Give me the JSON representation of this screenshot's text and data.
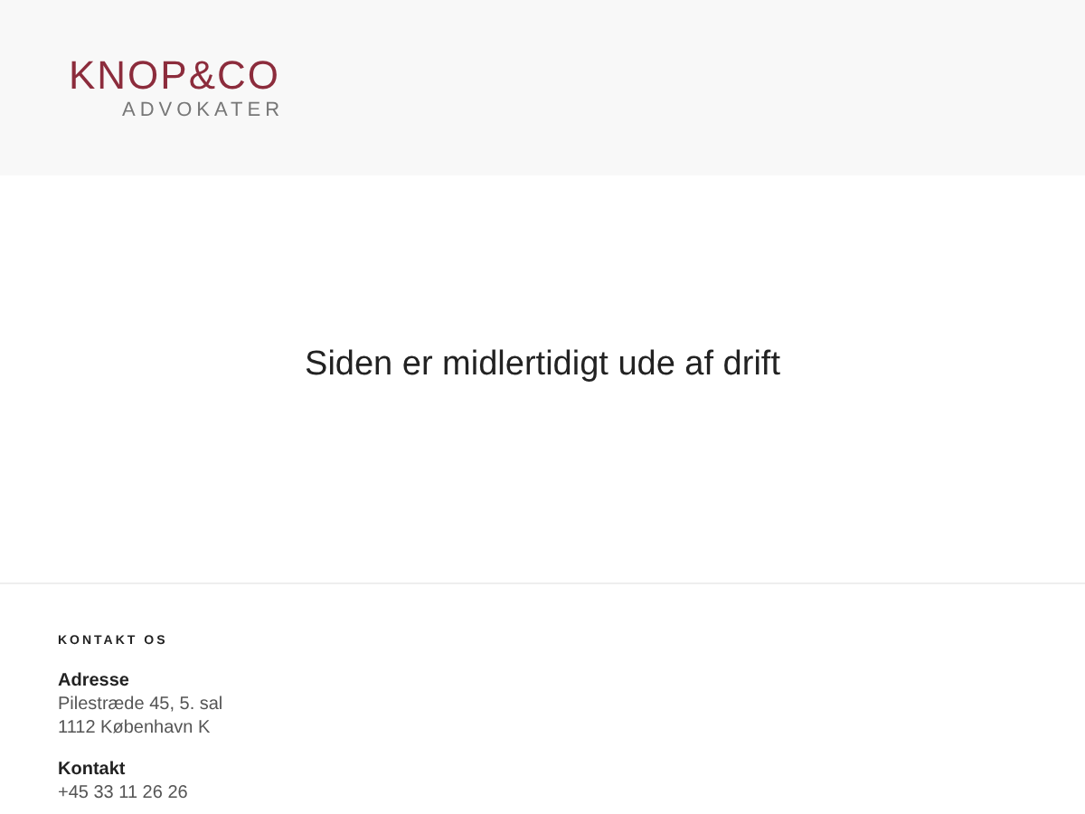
{
  "header": {
    "logo": {
      "name": "KNOP&CO",
      "tagline": "ADVOKATER"
    }
  },
  "main": {
    "message": "Siden er midlertidigt ude af drift"
  },
  "footer": {
    "heading": "KONTAKT OS",
    "sections": [
      {
        "title": "Adresse",
        "lines": [
          "Pilestræde 45, 5. sal",
          "1112 København K"
        ]
      },
      {
        "title": "Kontakt",
        "lines": [
          "+45 33 11 26 26"
        ]
      }
    ]
  }
}
